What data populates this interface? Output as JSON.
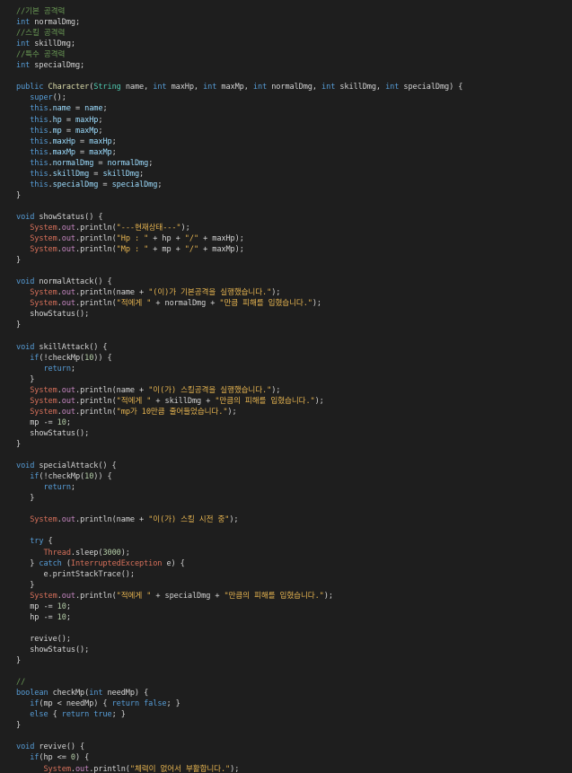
{
  "colors": {
    "background": "#1e1e1e",
    "plain": "#d4d4d4",
    "keyword": "#569cd6",
    "variable": "#9cdcfe",
    "function": "#dcdcaa",
    "string": "#ce9178",
    "korean_string": "#e6b450",
    "comment": "#6a9955",
    "number": "#b5cea8",
    "type": "#4ec9b0",
    "system": "#d6705a",
    "ref": "#c586c0"
  },
  "code": {
    "lines": [
      [
        [
          "cmt",
          "//기본 공격력"
        ]
      ],
      [
        [
          "kw",
          "int "
        ],
        [
          "plain",
          "normalDmg;"
        ]
      ],
      [
        [
          "cmt",
          "//스킬 공격력"
        ]
      ],
      [
        [
          "kw",
          "int "
        ],
        [
          "plain",
          "skillDmg;"
        ]
      ],
      [
        [
          "cmt",
          "//특수 공격력"
        ]
      ],
      [
        [
          "kw",
          "int "
        ],
        [
          "plain",
          "specialDmg;"
        ]
      ],
      [],
      [
        [
          "kw",
          "public "
        ],
        [
          "fn",
          "Character"
        ],
        [
          "plain",
          "("
        ],
        [
          "type",
          "String "
        ],
        [
          "plain",
          "name, "
        ],
        [
          "kw",
          "int "
        ],
        [
          "plain",
          "maxHp, "
        ],
        [
          "kw",
          "int "
        ],
        [
          "plain",
          "maxMp, "
        ],
        [
          "kw",
          "int "
        ],
        [
          "plain",
          "normalDmg, "
        ],
        [
          "kw",
          "int "
        ],
        [
          "plain",
          "skillDmg, "
        ],
        [
          "kw",
          "int "
        ],
        [
          "plain",
          "specialDmg) {"
        ]
      ],
      [
        [
          "plain",
          "   "
        ],
        [
          "kw",
          "super"
        ],
        [
          "plain",
          "();"
        ]
      ],
      [
        [
          "plain",
          "   "
        ],
        [
          "kw",
          "this"
        ],
        [
          "plain",
          "."
        ],
        [
          "var",
          "name"
        ],
        [
          "plain",
          " = "
        ],
        [
          "var",
          "name"
        ],
        [
          "plain",
          ";"
        ]
      ],
      [
        [
          "plain",
          "   "
        ],
        [
          "kw",
          "this"
        ],
        [
          "plain",
          "."
        ],
        [
          "var",
          "hp"
        ],
        [
          "plain",
          " = "
        ],
        [
          "var",
          "maxHp"
        ],
        [
          "plain",
          ";"
        ]
      ],
      [
        [
          "plain",
          "   "
        ],
        [
          "kw",
          "this"
        ],
        [
          "plain",
          "."
        ],
        [
          "var",
          "mp"
        ],
        [
          "plain",
          " = "
        ],
        [
          "var",
          "maxMp"
        ],
        [
          "plain",
          ";"
        ]
      ],
      [
        [
          "plain",
          "   "
        ],
        [
          "kw",
          "this"
        ],
        [
          "plain",
          "."
        ],
        [
          "var",
          "maxHp"
        ],
        [
          "plain",
          " = "
        ],
        [
          "var",
          "maxHp"
        ],
        [
          "plain",
          ";"
        ]
      ],
      [
        [
          "plain",
          "   "
        ],
        [
          "kw",
          "this"
        ],
        [
          "plain",
          "."
        ],
        [
          "var",
          "maxMp"
        ],
        [
          "plain",
          " = "
        ],
        [
          "var",
          "maxMp"
        ],
        [
          "plain",
          ";"
        ]
      ],
      [
        [
          "plain",
          "   "
        ],
        [
          "kw",
          "this"
        ],
        [
          "plain",
          "."
        ],
        [
          "var",
          "normalDmg"
        ],
        [
          "plain",
          " = "
        ],
        [
          "var",
          "normalDmg"
        ],
        [
          "plain",
          ";"
        ]
      ],
      [
        [
          "plain",
          "   "
        ],
        [
          "kw",
          "this"
        ],
        [
          "plain",
          "."
        ],
        [
          "var",
          "skillDmg"
        ],
        [
          "plain",
          " = "
        ],
        [
          "var",
          "skillDmg"
        ],
        [
          "plain",
          ";"
        ]
      ],
      [
        [
          "plain",
          "   "
        ],
        [
          "kw",
          "this"
        ],
        [
          "plain",
          "."
        ],
        [
          "var",
          "specialDmg"
        ],
        [
          "plain",
          " = "
        ],
        [
          "var",
          "specialDmg"
        ],
        [
          "plain",
          ";"
        ]
      ],
      [
        [
          "plain",
          "}"
        ]
      ],
      [],
      [
        [
          "kw",
          "void "
        ],
        [
          "plain",
          "showStatus() {"
        ]
      ],
      [
        [
          "plain",
          "   "
        ],
        [
          "sys",
          "System"
        ],
        [
          "plain",
          "."
        ],
        [
          "ref",
          "out"
        ],
        [
          "plain",
          ".println("
        ],
        [
          "str2",
          "\"---현재상태---\""
        ],
        [
          "plain",
          ");"
        ]
      ],
      [
        [
          "plain",
          "   "
        ],
        [
          "sys",
          "System"
        ],
        [
          "plain",
          "."
        ],
        [
          "ref",
          "out"
        ],
        [
          "plain",
          ".println("
        ],
        [
          "str2",
          "\"Hp : \""
        ],
        [
          "plain",
          " + hp + "
        ],
        [
          "str2",
          "\"/\""
        ],
        [
          "plain",
          " + maxHp);"
        ]
      ],
      [
        [
          "plain",
          "   "
        ],
        [
          "sys",
          "System"
        ],
        [
          "plain",
          "."
        ],
        [
          "ref",
          "out"
        ],
        [
          "plain",
          ".println("
        ],
        [
          "str2",
          "\"Mp : \""
        ],
        [
          "plain",
          " + mp + "
        ],
        [
          "str2",
          "\"/\""
        ],
        [
          "plain",
          " + maxMp);"
        ]
      ],
      [
        [
          "plain",
          "}"
        ]
      ],
      [],
      [
        [
          "kw",
          "void "
        ],
        [
          "plain",
          "normalAttack() {"
        ]
      ],
      [
        [
          "plain",
          "   "
        ],
        [
          "sys",
          "System"
        ],
        [
          "plain",
          "."
        ],
        [
          "ref",
          "out"
        ],
        [
          "plain",
          ".println(name + "
        ],
        [
          "str2",
          "\"(이)가 기본공격을 실행했습니다.\""
        ],
        [
          "plain",
          ");"
        ]
      ],
      [
        [
          "plain",
          "   "
        ],
        [
          "sys",
          "System"
        ],
        [
          "plain",
          "."
        ],
        [
          "ref",
          "out"
        ],
        [
          "plain",
          ".println("
        ],
        [
          "str2",
          "\"적에게 \""
        ],
        [
          "plain",
          " + normalDmg + "
        ],
        [
          "str2",
          "\"만큼 피해를 입혔습니다.\""
        ],
        [
          "plain",
          ");"
        ]
      ],
      [
        [
          "plain",
          "   showStatus();"
        ]
      ],
      [
        [
          "plain",
          "}"
        ]
      ],
      [],
      [
        [
          "kw",
          "void "
        ],
        [
          "plain",
          "skillAttack() {"
        ]
      ],
      [
        [
          "plain",
          "   "
        ],
        [
          "kw",
          "if"
        ],
        [
          "plain",
          "(!checkMp("
        ],
        [
          "num",
          "10"
        ],
        [
          "plain",
          ")) {"
        ]
      ],
      [
        [
          "plain",
          "      "
        ],
        [
          "kw",
          "return"
        ],
        [
          "plain",
          ";"
        ]
      ],
      [
        [
          "plain",
          "   }"
        ]
      ],
      [
        [
          "plain",
          "   "
        ],
        [
          "sys",
          "System"
        ],
        [
          "plain",
          "."
        ],
        [
          "ref",
          "out"
        ],
        [
          "plain",
          ".println(name + "
        ],
        [
          "str2",
          "\"이(가) 스킬공격을 실행했습니다.\""
        ],
        [
          "plain",
          ");"
        ]
      ],
      [
        [
          "plain",
          "   "
        ],
        [
          "sys",
          "System"
        ],
        [
          "plain",
          "."
        ],
        [
          "ref",
          "out"
        ],
        [
          "plain",
          ".println("
        ],
        [
          "str2",
          "\"적에게 \""
        ],
        [
          "plain",
          " + skillDmg + "
        ],
        [
          "str2",
          "\"만큼의 피해를 입혔습니다.\""
        ],
        [
          "plain",
          ");"
        ]
      ],
      [
        [
          "plain",
          "   "
        ],
        [
          "sys",
          "System"
        ],
        [
          "plain",
          "."
        ],
        [
          "ref",
          "out"
        ],
        [
          "plain",
          ".println("
        ],
        [
          "str2",
          "\"mp가 10만큼 줄어들었습니다.\""
        ],
        [
          "plain",
          ");"
        ]
      ],
      [
        [
          "plain",
          "   mp -= "
        ],
        [
          "num",
          "10"
        ],
        [
          "plain",
          ";"
        ]
      ],
      [
        [
          "plain",
          "   showStatus();"
        ]
      ],
      [
        [
          "plain",
          "}"
        ]
      ],
      [],
      [
        [
          "kw",
          "void "
        ],
        [
          "plain",
          "specialAttack() {"
        ]
      ],
      [
        [
          "plain",
          "   "
        ],
        [
          "kw",
          "if"
        ],
        [
          "plain",
          "(!checkMp("
        ],
        [
          "num",
          "10"
        ],
        [
          "plain",
          ")) {"
        ]
      ],
      [
        [
          "plain",
          "      "
        ],
        [
          "kw",
          "return"
        ],
        [
          "plain",
          ";"
        ]
      ],
      [
        [
          "plain",
          "   }"
        ]
      ],
      [],
      [
        [
          "plain",
          "   "
        ],
        [
          "sys",
          "System"
        ],
        [
          "plain",
          "."
        ],
        [
          "ref",
          "out"
        ],
        [
          "plain",
          ".println(name + "
        ],
        [
          "str2",
          "\"이(가) 스킬 시전 중\""
        ],
        [
          "plain",
          ");"
        ]
      ],
      [],
      [
        [
          "plain",
          "   "
        ],
        [
          "kw",
          "try"
        ],
        [
          "plain",
          " {"
        ]
      ],
      [
        [
          "plain",
          "      "
        ],
        [
          "sys",
          "Thread"
        ],
        [
          "plain",
          ".sleep("
        ],
        [
          "num",
          "3000"
        ],
        [
          "plain",
          ");"
        ]
      ],
      [
        [
          "plain",
          "   } "
        ],
        [
          "kw",
          "catch"
        ],
        [
          "plain",
          " ("
        ],
        [
          "sys",
          "InterruptedException"
        ],
        [
          "plain",
          " e) {"
        ]
      ],
      [
        [
          "plain",
          "      e.printStackTrace();"
        ]
      ],
      [
        [
          "plain",
          "   }"
        ]
      ],
      [
        [
          "plain",
          "   "
        ],
        [
          "sys",
          "System"
        ],
        [
          "plain",
          "."
        ],
        [
          "ref",
          "out"
        ],
        [
          "plain",
          ".println("
        ],
        [
          "str2",
          "\"적에게 \""
        ],
        [
          "plain",
          " + specialDmg + "
        ],
        [
          "str2",
          "\"만큼의 피해를 입혔습니다.\""
        ],
        [
          "plain",
          ");"
        ]
      ],
      [
        [
          "plain",
          "   mp -= "
        ],
        [
          "num",
          "10"
        ],
        [
          "plain",
          ";"
        ]
      ],
      [
        [
          "plain",
          "   hp -= "
        ],
        [
          "num",
          "10"
        ],
        [
          "plain",
          ";"
        ]
      ],
      [],
      [
        [
          "plain",
          "   revive();"
        ]
      ],
      [
        [
          "plain",
          "   showStatus();"
        ]
      ],
      [
        [
          "plain",
          "}"
        ]
      ],
      [],
      [
        [
          "cmt",
          "//"
        ]
      ],
      [
        [
          "kw",
          "boolean "
        ],
        [
          "plain",
          "checkMp("
        ],
        [
          "kw",
          "int "
        ],
        [
          "plain",
          "needMp) {"
        ]
      ],
      [
        [
          "plain",
          "   "
        ],
        [
          "kw",
          "if"
        ],
        [
          "plain",
          "(mp < needMp) { "
        ],
        [
          "kw",
          "return false"
        ],
        [
          "plain",
          "; }"
        ]
      ],
      [
        [
          "plain",
          "   "
        ],
        [
          "kw",
          "else"
        ],
        [
          "plain",
          " { "
        ],
        [
          "kw",
          "return true"
        ],
        [
          "plain",
          "; }"
        ]
      ],
      [
        [
          "plain",
          "}"
        ]
      ],
      [],
      [
        [
          "kw",
          "void "
        ],
        [
          "plain",
          "revive() {"
        ]
      ],
      [
        [
          "plain",
          "   "
        ],
        [
          "kw",
          "if"
        ],
        [
          "plain",
          "(hp <= "
        ],
        [
          "num",
          "0"
        ],
        [
          "plain",
          ") {"
        ]
      ],
      [
        [
          "plain",
          "      "
        ],
        [
          "sys",
          "System"
        ],
        [
          "plain",
          "."
        ],
        [
          "ref",
          "out"
        ],
        [
          "plain",
          ".println("
        ],
        [
          "str2",
          "\"체력이 없어서 부활합니다.\""
        ],
        [
          "plain",
          ");"
        ]
      ]
    ]
  }
}
